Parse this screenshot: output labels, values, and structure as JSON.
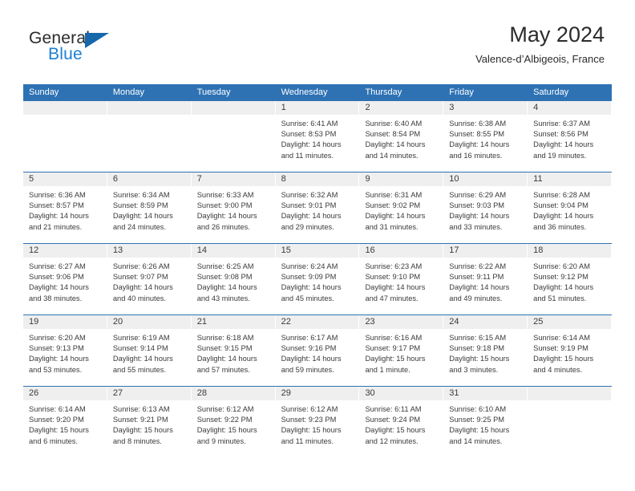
{
  "brand": {
    "name_top": "General",
    "name_bottom": "Blue",
    "triangle_color": "#1767ab",
    "blue_text_color": "#1a7fd4"
  },
  "header": {
    "title": "May 2024",
    "subtitle": "Valence-d’Albigeois, France"
  },
  "theme": {
    "header_blue": "#2e72b4",
    "day_band_gray": "#efefef",
    "text_color": "#3a3a3a"
  },
  "weekdays": [
    "Sunday",
    "Monday",
    "Tuesday",
    "Wednesday",
    "Thursday",
    "Friday",
    "Saturday"
  ],
  "weeks": [
    [
      {
        "day": "",
        "sunrise": "",
        "sunset": "",
        "daylight_1": "",
        "daylight_2": ""
      },
      {
        "day": "",
        "sunrise": "",
        "sunset": "",
        "daylight_1": "",
        "daylight_2": ""
      },
      {
        "day": "",
        "sunrise": "",
        "sunset": "",
        "daylight_1": "",
        "daylight_2": ""
      },
      {
        "day": "1",
        "sunrise": "Sunrise: 6:41 AM",
        "sunset": "Sunset: 8:53 PM",
        "daylight_1": "Daylight: 14 hours",
        "daylight_2": "and 11 minutes."
      },
      {
        "day": "2",
        "sunrise": "Sunrise: 6:40 AM",
        "sunset": "Sunset: 8:54 PM",
        "daylight_1": "Daylight: 14 hours",
        "daylight_2": "and 14 minutes."
      },
      {
        "day": "3",
        "sunrise": "Sunrise: 6:38 AM",
        "sunset": "Sunset: 8:55 PM",
        "daylight_1": "Daylight: 14 hours",
        "daylight_2": "and 16 minutes."
      },
      {
        "day": "4",
        "sunrise": "Sunrise: 6:37 AM",
        "sunset": "Sunset: 8:56 PM",
        "daylight_1": "Daylight: 14 hours",
        "daylight_2": "and 19 minutes."
      }
    ],
    [
      {
        "day": "5",
        "sunrise": "Sunrise: 6:36 AM",
        "sunset": "Sunset: 8:57 PM",
        "daylight_1": "Daylight: 14 hours",
        "daylight_2": "and 21 minutes."
      },
      {
        "day": "6",
        "sunrise": "Sunrise: 6:34 AM",
        "sunset": "Sunset: 8:59 PM",
        "daylight_1": "Daylight: 14 hours",
        "daylight_2": "and 24 minutes."
      },
      {
        "day": "7",
        "sunrise": "Sunrise: 6:33 AM",
        "sunset": "Sunset: 9:00 PM",
        "daylight_1": "Daylight: 14 hours",
        "daylight_2": "and 26 minutes."
      },
      {
        "day": "8",
        "sunrise": "Sunrise: 6:32 AM",
        "sunset": "Sunset: 9:01 PM",
        "daylight_1": "Daylight: 14 hours",
        "daylight_2": "and 29 minutes."
      },
      {
        "day": "9",
        "sunrise": "Sunrise: 6:31 AM",
        "sunset": "Sunset: 9:02 PM",
        "daylight_1": "Daylight: 14 hours",
        "daylight_2": "and 31 minutes."
      },
      {
        "day": "10",
        "sunrise": "Sunrise: 6:29 AM",
        "sunset": "Sunset: 9:03 PM",
        "daylight_1": "Daylight: 14 hours",
        "daylight_2": "and 33 minutes."
      },
      {
        "day": "11",
        "sunrise": "Sunrise: 6:28 AM",
        "sunset": "Sunset: 9:04 PM",
        "daylight_1": "Daylight: 14 hours",
        "daylight_2": "and 36 minutes."
      }
    ],
    [
      {
        "day": "12",
        "sunrise": "Sunrise: 6:27 AM",
        "sunset": "Sunset: 9:06 PM",
        "daylight_1": "Daylight: 14 hours",
        "daylight_2": "and 38 minutes."
      },
      {
        "day": "13",
        "sunrise": "Sunrise: 6:26 AM",
        "sunset": "Sunset: 9:07 PM",
        "daylight_1": "Daylight: 14 hours",
        "daylight_2": "and 40 minutes."
      },
      {
        "day": "14",
        "sunrise": "Sunrise: 6:25 AM",
        "sunset": "Sunset: 9:08 PM",
        "daylight_1": "Daylight: 14 hours",
        "daylight_2": "and 43 minutes."
      },
      {
        "day": "15",
        "sunrise": "Sunrise: 6:24 AM",
        "sunset": "Sunset: 9:09 PM",
        "daylight_1": "Daylight: 14 hours",
        "daylight_2": "and 45 minutes."
      },
      {
        "day": "16",
        "sunrise": "Sunrise: 6:23 AM",
        "sunset": "Sunset: 9:10 PM",
        "daylight_1": "Daylight: 14 hours",
        "daylight_2": "and 47 minutes."
      },
      {
        "day": "17",
        "sunrise": "Sunrise: 6:22 AM",
        "sunset": "Sunset: 9:11 PM",
        "daylight_1": "Daylight: 14 hours",
        "daylight_2": "and 49 minutes."
      },
      {
        "day": "18",
        "sunrise": "Sunrise: 6:20 AM",
        "sunset": "Sunset: 9:12 PM",
        "daylight_1": "Daylight: 14 hours",
        "daylight_2": "and 51 minutes."
      }
    ],
    [
      {
        "day": "19",
        "sunrise": "Sunrise: 6:20 AM",
        "sunset": "Sunset: 9:13 PM",
        "daylight_1": "Daylight: 14 hours",
        "daylight_2": "and 53 minutes."
      },
      {
        "day": "20",
        "sunrise": "Sunrise: 6:19 AM",
        "sunset": "Sunset: 9:14 PM",
        "daylight_1": "Daylight: 14 hours",
        "daylight_2": "and 55 minutes."
      },
      {
        "day": "21",
        "sunrise": "Sunrise: 6:18 AM",
        "sunset": "Sunset: 9:15 PM",
        "daylight_1": "Daylight: 14 hours",
        "daylight_2": "and 57 minutes."
      },
      {
        "day": "22",
        "sunrise": "Sunrise: 6:17 AM",
        "sunset": "Sunset: 9:16 PM",
        "daylight_1": "Daylight: 14 hours",
        "daylight_2": "and 59 minutes."
      },
      {
        "day": "23",
        "sunrise": "Sunrise: 6:16 AM",
        "sunset": "Sunset: 9:17 PM",
        "daylight_1": "Daylight: 15 hours",
        "daylight_2": "and 1 minute."
      },
      {
        "day": "24",
        "sunrise": "Sunrise: 6:15 AM",
        "sunset": "Sunset: 9:18 PM",
        "daylight_1": "Daylight: 15 hours",
        "daylight_2": "and 3 minutes."
      },
      {
        "day": "25",
        "sunrise": "Sunrise: 6:14 AM",
        "sunset": "Sunset: 9:19 PM",
        "daylight_1": "Daylight: 15 hours",
        "daylight_2": "and 4 minutes."
      }
    ],
    [
      {
        "day": "26",
        "sunrise": "Sunrise: 6:14 AM",
        "sunset": "Sunset: 9:20 PM",
        "daylight_1": "Daylight: 15 hours",
        "daylight_2": "and 6 minutes."
      },
      {
        "day": "27",
        "sunrise": "Sunrise: 6:13 AM",
        "sunset": "Sunset: 9:21 PM",
        "daylight_1": "Daylight: 15 hours",
        "daylight_2": "and 8 minutes."
      },
      {
        "day": "28",
        "sunrise": "Sunrise: 6:12 AM",
        "sunset": "Sunset: 9:22 PM",
        "daylight_1": "Daylight: 15 hours",
        "daylight_2": "and 9 minutes."
      },
      {
        "day": "29",
        "sunrise": "Sunrise: 6:12 AM",
        "sunset": "Sunset: 9:23 PM",
        "daylight_1": "Daylight: 15 hours",
        "daylight_2": "and 11 minutes."
      },
      {
        "day": "30",
        "sunrise": "Sunrise: 6:11 AM",
        "sunset": "Sunset: 9:24 PM",
        "daylight_1": "Daylight: 15 hours",
        "daylight_2": "and 12 minutes."
      },
      {
        "day": "31",
        "sunrise": "Sunrise: 6:10 AM",
        "sunset": "Sunset: 9:25 PM",
        "daylight_1": "Daylight: 15 hours",
        "daylight_2": "and 14 minutes."
      },
      {
        "day": "",
        "sunrise": "",
        "sunset": "",
        "daylight_1": "",
        "daylight_2": ""
      }
    ]
  ]
}
